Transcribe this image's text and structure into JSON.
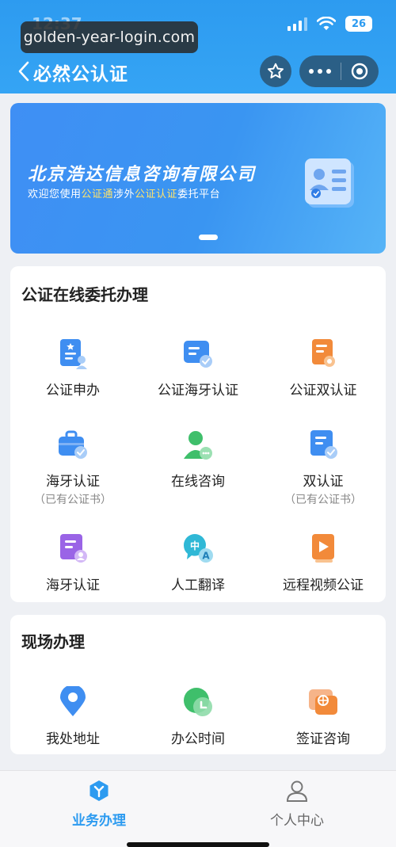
{
  "status_bar": {
    "time": "12:37",
    "battery": "26"
  },
  "url_overlay": "golden-year-login.com",
  "nav": {
    "title": "必然公认证"
  },
  "banner": {
    "company": "北京浩达信息咨询有限公司",
    "tagline_parts": [
      "欢迎您使用",
      "公证通",
      "涉外",
      "公证认证",
      "委托平台"
    ]
  },
  "online": {
    "title": "公证在线委托办理",
    "items": [
      {
        "label": "公证申办",
        "sub": "",
        "icon": "notary-apply-icon"
      },
      {
        "label": "公证海牙认证",
        "sub": "",
        "icon": "hague-notary-icon"
      },
      {
        "label": "公证双认证",
        "sub": "",
        "icon": "double-notary-icon"
      },
      {
        "label": "海牙认证",
        "sub": "（已有公证书）",
        "icon": "hague-cert-bag-icon"
      },
      {
        "label": "在线咨询",
        "sub": "",
        "icon": "online-consult-icon"
      },
      {
        "label": "双认证",
        "sub": "（已有公证书）",
        "icon": "double-cert-icon"
      },
      {
        "label": "海牙认证",
        "sub": "",
        "icon": "hague-cert-icon"
      },
      {
        "label": "人工翻译",
        "sub": "",
        "icon": "translation-icon"
      },
      {
        "label": "远程视频公证",
        "sub": "",
        "icon": "video-notary-icon"
      }
    ]
  },
  "onsite": {
    "title": "现场办理",
    "items": [
      {
        "label": "我处地址",
        "icon": "location-pin-icon"
      },
      {
        "label": "办公时间",
        "icon": "clock-icon"
      },
      {
        "label": "签证咨询",
        "icon": "visa-consult-icon"
      }
    ]
  },
  "tabbar": {
    "tabs": [
      {
        "label": "业务办理",
        "active": true
      },
      {
        "label": "个人中心",
        "active": false
      }
    ]
  },
  "colors": {
    "primary": "#2d9bf0",
    "highlight": "#ffe36b"
  }
}
